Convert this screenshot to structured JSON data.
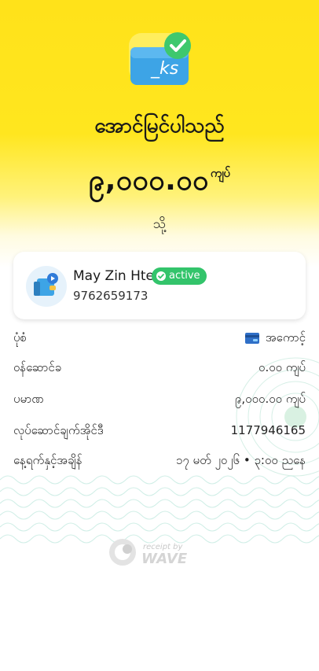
{
  "header": {
    "icon": "ks-success-wallet-icon",
    "icon_text": "_ks",
    "title": "အောင်မြင်ပါသည်",
    "amount": "၉,၀၀၀.၀၀",
    "amount_unit": "ကျပ်",
    "to_label": "သို့"
  },
  "recipient": {
    "avatar_icon": "wave-wallet-icon",
    "name": "May Zin Htet",
    "badge": "active",
    "phone": "9762659173"
  },
  "details": [
    {
      "label": "ပုံစံ",
      "value": "အကောင့်",
      "icon": "account-card-icon"
    },
    {
      "label": "ဝန်ဆောင်ခ",
      "value": "၀.၀၀ ကျပ်"
    },
    {
      "label": "ပမာဏ",
      "value": "၉,၀၀၀.၀၀ ကျပ်"
    },
    {
      "label": "လုပ်ဆောင်ချက်အိုင်ဒီ",
      "value": "1177946165"
    },
    {
      "label": "နေ့ရက်နှင့်အချိန်",
      "value": "၁၇ မတ် ၂၀၂၆ • ၃:၀၀ ညနေ"
    }
  ],
  "footer": {
    "line1": "receipt by",
    "line2": "WAVE"
  },
  "colors": {
    "brand_yellow": "#ffe21a",
    "success_green": "#33c46b",
    "icon_blue": "#3da4e6"
  }
}
